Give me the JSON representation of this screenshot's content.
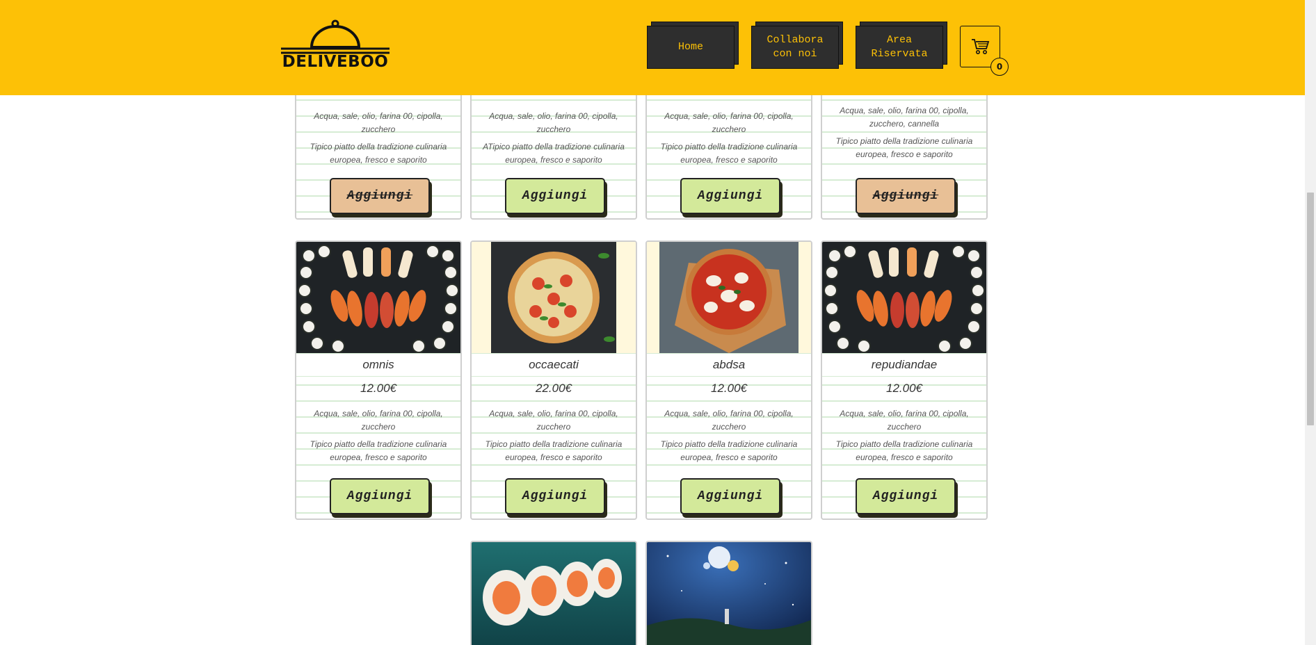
{
  "header": {
    "logo_text": "DELIVEBOO",
    "nav": [
      {
        "label_line1": "Home",
        "label_line2": ""
      },
      {
        "label_line1": "Collabora",
        "label_line2": "con noi"
      },
      {
        "label_line1": "Area",
        "label_line2": "Riservata"
      }
    ],
    "cart_count": "0"
  },
  "row1": [
    {
      "ingredients": "Acqua, sale, olio, farina 00, cipolla, zucchero",
      "description": "Tipico piatto della tradizione culinaria europea, fresco e saporito",
      "button": "Aggiungi",
      "disabled": true
    },
    {
      "ingredients": "Acqua, sale, olio, farina 00, cipolla, zucchero",
      "description": "ATipico piatto della tradizione culinaria europea, fresco e saporito",
      "button": "Aggiungi",
      "disabled": false
    },
    {
      "ingredients": "Acqua, sale, olio, farina 00, cipolla, zucchero",
      "description": "Tipico piatto della tradizione culinaria europea, fresco e saporito",
      "button": "Aggiungi",
      "disabled": false
    },
    {
      "ingredients": "Acqua, sale, olio, farina 00, cipolla, zucchero, cannella",
      "description": "Tipico piatto della tradizione culinaria europea, fresco e saporito",
      "button": "Aggiungi",
      "disabled": true
    }
  ],
  "row2": [
    {
      "name": "omnis",
      "price": "12.00€",
      "ingredients": "Acqua, sale, olio, farina 00, cipolla, zucchero",
      "description": "Tipico piatto della tradizione culinaria europea, fresco e saporito",
      "button": "Aggiungi",
      "image": "sushi-platter"
    },
    {
      "name": "occaecati",
      "price": "22.00€",
      "ingredients": "Acqua, sale, olio, farina 00, cipolla, zucchero",
      "description": "Tipico piatto della tradizione culinaria europea, fresco e saporito",
      "button": "Aggiungi",
      "image": "pizza"
    },
    {
      "name": "abdsa",
      "price": "12.00€",
      "ingredients": "Acqua, sale, olio, farina 00, cipolla, zucchero",
      "description": "Tipico piatto della tradizione culinaria europea, fresco e saporito",
      "button": "Aggiungi",
      "image": "pizza-margherita"
    },
    {
      "name": "repudiandae",
      "price": "12.00€",
      "ingredients": "Acqua, sale, olio, farina 00, cipolla, zucchero",
      "description": "Tipico piatto della tradizione culinaria europea, fresco e saporito",
      "button": "Aggiungi",
      "image": "sushi-platter"
    }
  ],
  "row3": [
    {
      "image": "sushi-rolls"
    },
    {
      "image": "night-sky-fantasy"
    }
  ]
}
